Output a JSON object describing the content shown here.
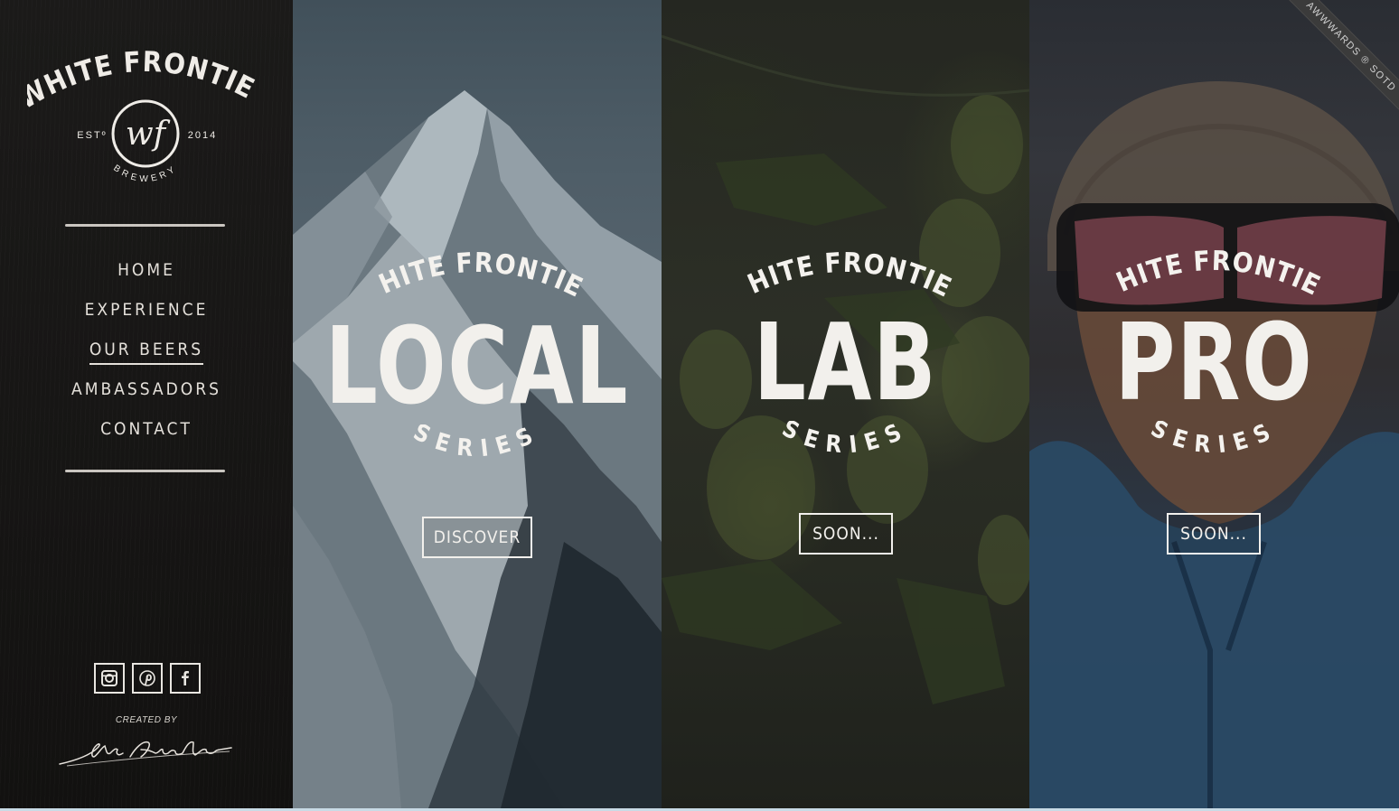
{
  "brand": {
    "name": "WHITE FRONTIER",
    "est_label": "ESTº",
    "year": "2014",
    "monogram": "wf",
    "sub": "BREWERY"
  },
  "nav": {
    "items": [
      {
        "label": "HOME",
        "active": false
      },
      {
        "label": "EXPERIENCE",
        "active": false
      },
      {
        "label": "OUR BEERS",
        "active": true
      },
      {
        "label": "AMBASSADORS",
        "active": false
      },
      {
        "label": "CONTACT",
        "active": false
      }
    ]
  },
  "social": {
    "icons": [
      "instagram-icon",
      "pinterest-icon",
      "facebook-icon"
    ]
  },
  "credit": {
    "label": "CREATED BY",
    "signature": "Mc Arnolds"
  },
  "panels": [
    {
      "brand": "WHITE FRONTIER",
      "name": "LOCAL",
      "suffix": "SERIES",
      "button": "DISCOVER"
    },
    {
      "brand": "WHITE FRONTIER",
      "name": "LAB",
      "suffix": "SERIES",
      "button": "SOON..."
    },
    {
      "brand": "WHITE FRONTIER",
      "name": "PRO",
      "suffix": "SERIES",
      "button": "SOON..."
    }
  ],
  "ribbon": {
    "label": "AWWWARDS ® SOTD"
  },
  "colors": {
    "sidebar": "#161514",
    "text": "#f2f0ec",
    "ribbon": "#3b3b3b"
  }
}
